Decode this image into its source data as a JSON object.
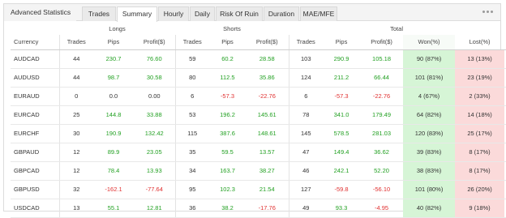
{
  "title": "Advanced Statistics",
  "tabs": [
    "Trades",
    "Summary",
    "Hourly",
    "Daily",
    "Risk Of Ruin",
    "Duration",
    "MAE/MFE"
  ],
  "active_tab": "Summary",
  "groups": {
    "longs": "Longs",
    "shorts": "Shorts",
    "total": "Total"
  },
  "columns": {
    "currency": "Currency",
    "trades": "Trades",
    "pips": "Pips",
    "profit": "Profit($)",
    "won": "Won(%)",
    "lost": "Lost(%)"
  },
  "colors": {
    "positive": "#22a022",
    "negative": "#e03030",
    "won_bg": "#d6f5d6",
    "lost_bg": "#fbdada"
  },
  "icons": {
    "menu": "more-dots-icon",
    "copy": "copy-icon",
    "row": "chart-icon"
  },
  "rows": [
    {
      "currency": "AUDCAD",
      "l_trades": "44",
      "l_pips": "230.7",
      "l_profit": "76.60",
      "s_trades": "59",
      "s_pips": "60.2",
      "s_profit": "28.58",
      "t_trades": "103",
      "t_pips": "290.9",
      "t_profit": "105.18",
      "won": "90 (87%)",
      "lost": "13 (13%)"
    },
    {
      "currency": "AUDUSD",
      "l_trades": "44",
      "l_pips": "98.7",
      "l_profit": "30.58",
      "s_trades": "80",
      "s_pips": "112.5",
      "s_profit": "35.86",
      "t_trades": "124",
      "t_pips": "211.2",
      "t_profit": "66.44",
      "won": "101 (81%)",
      "lost": "23 (19%)"
    },
    {
      "currency": "EURAUD",
      "l_trades": "0",
      "l_pips": "0.0",
      "l_profit": "0.00",
      "s_trades": "6",
      "s_pips": "-57.3",
      "s_profit": "-22.76",
      "t_trades": "6",
      "t_pips": "-57.3",
      "t_profit": "-22.76",
      "won": "4 (67%)",
      "lost": "2 (33%)"
    },
    {
      "currency": "EURCAD",
      "l_trades": "25",
      "l_pips": "144.8",
      "l_profit": "33.88",
      "s_trades": "53",
      "s_pips": "196.2",
      "s_profit": "145.61",
      "t_trades": "78",
      "t_pips": "341.0",
      "t_profit": "179.49",
      "won": "64 (82%)",
      "lost": "14 (18%)"
    },
    {
      "currency": "EURCHF",
      "l_trades": "30",
      "l_pips": "190.9",
      "l_profit": "132.42",
      "s_trades": "115",
      "s_pips": "387.6",
      "s_profit": "148.61",
      "t_trades": "145",
      "t_pips": "578.5",
      "t_profit": "281.03",
      "won": "120 (83%)",
      "lost": "25 (17%)"
    },
    {
      "currency": "GBPAUD",
      "l_trades": "12",
      "l_pips": "89.9",
      "l_profit": "23.05",
      "s_trades": "35",
      "s_pips": "59.5",
      "s_profit": "13.57",
      "t_trades": "47",
      "t_pips": "149.4",
      "t_profit": "36.62",
      "won": "39 (83%)",
      "lost": "8 (17%)"
    },
    {
      "currency": "GBPCAD",
      "l_trades": "12",
      "l_pips": "78.4",
      "l_profit": "13.93",
      "s_trades": "34",
      "s_pips": "163.7",
      "s_profit": "38.27",
      "t_trades": "46",
      "t_pips": "242.1",
      "t_profit": "52.20",
      "won": "38 (83%)",
      "lost": "8 (17%)"
    },
    {
      "currency": "GBPUSD",
      "l_trades": "32",
      "l_pips": "-162.1",
      "l_profit": "-77.64",
      "s_trades": "95",
      "s_pips": "102.3",
      "s_profit": "21.54",
      "t_trades": "127",
      "t_pips": "-59.8",
      "t_profit": "-56.10",
      "won": "101 (80%)",
      "lost": "26 (20%)"
    },
    {
      "currency": "USDCAD",
      "l_trades": "13",
      "l_pips": "55.1",
      "l_profit": "12.81",
      "s_trades": "36",
      "s_pips": "38.2",
      "s_profit": "-17.76",
      "t_trades": "49",
      "t_pips": "93.3",
      "t_profit": "-4.95",
      "won": "40 (82%)",
      "lost": "9 (18%)"
    }
  ]
}
